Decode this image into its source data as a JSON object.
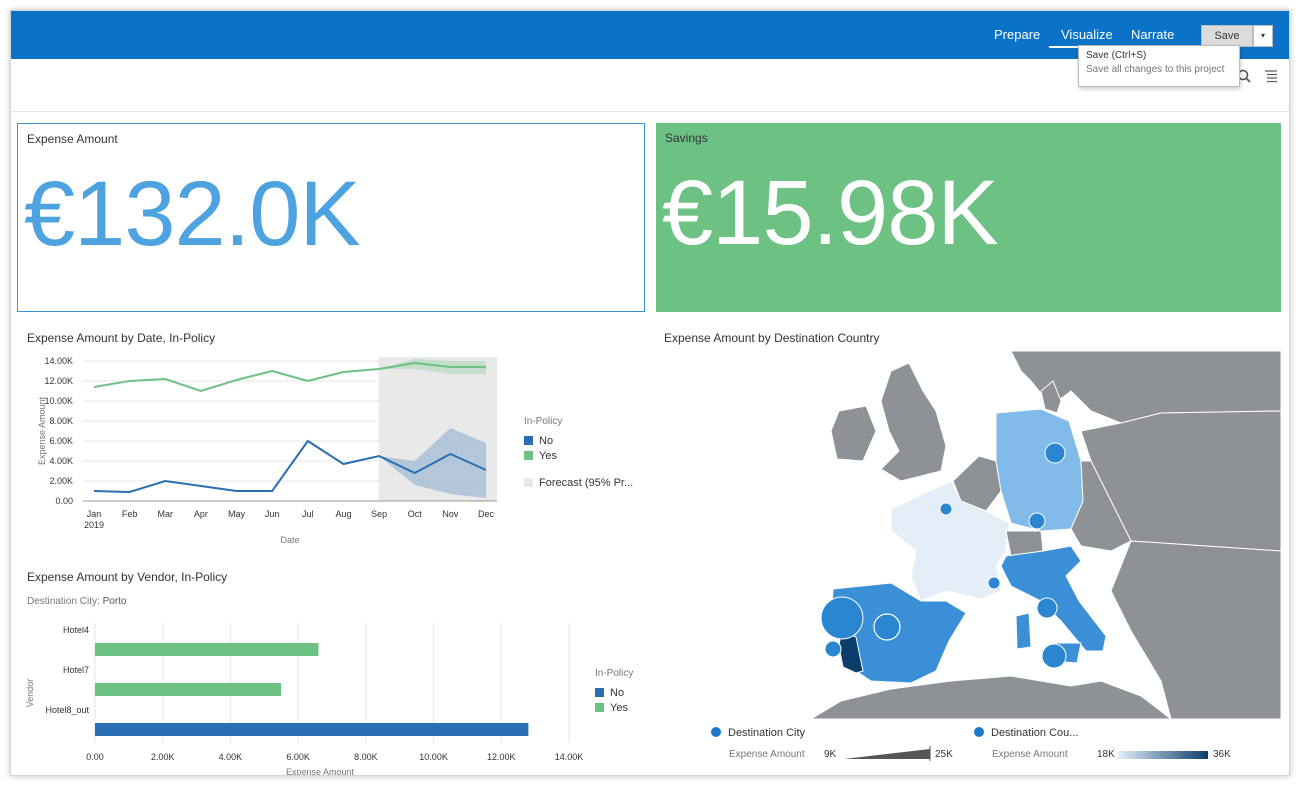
{
  "topbar": {
    "tabs": [
      "Prepare",
      "Visualize",
      "Narrate"
    ],
    "save_label": "Save",
    "dropdown_glyph": "▾"
  },
  "tooltip": {
    "line1": "Save (Ctrl+S)",
    "line2": "Save all changes to this project"
  },
  "icons": [
    "search-icon",
    "menu-icon"
  ],
  "kpis": {
    "expense": {
      "title": "Expense Amount",
      "value": "€132.0K"
    },
    "savings": {
      "title": "Savings",
      "value": "€15.98K"
    }
  },
  "colors": {
    "topbar": "#0a72c7",
    "kpi_blue": "#4da3e0",
    "kpi_green": "#6cc183",
    "series_no": "#2a6fb3",
    "series_yes": "#6cc183",
    "land": "#8e9196",
    "water": "#ffffff"
  },
  "line_chart": {
    "title": "Expense Amount by Date, In-Policy",
    "chart_data": {
      "type": "line",
      "x": [
        "Jan",
        "Feb",
        "Mar",
        "Apr",
        "May",
        "Jun",
        "Jul",
        "Aug",
        "Sep",
        "Oct",
        "Nov",
        "Dec"
      ],
      "x_sub_first": "2019",
      "xlabel": "Date",
      "ylabel": "Expense Amount",
      "ylim": [
        0,
        14000
      ],
      "yticks": [
        "0.00",
        "2.00K",
        "4.00K",
        "6.00K",
        "8.00K",
        "10.00K",
        "12.00K",
        "14.00K"
      ],
      "series": [
        {
          "name": "No",
          "values": [
            1000,
            900,
            2000,
            1500,
            1000,
            1000,
            6000,
            3700,
            4500,
            2800,
            4700,
            3100
          ],
          "forecast_band": [
            [
              4500,
              4500
            ],
            [
              1600,
              4000
            ],
            [
              700,
              7300
            ],
            [
              300,
              5800
            ]
          ]
        },
        {
          "name": "Yes",
          "values": [
            11400,
            12000,
            12200,
            11000,
            12100,
            13000,
            12000,
            12900,
            13200,
            13800,
            13400,
            13400
          ],
          "forecast_band": [
            [
              13200,
              13200
            ],
            [
              13200,
              14200
            ],
            [
              12700,
              14000
            ],
            [
              12700,
              14000
            ]
          ]
        }
      ],
      "forecast_start_index": 8,
      "legend": {
        "title": "In-Policy",
        "items": [
          "No",
          "Yes"
        ],
        "forecast_label": "Forecast (95% Pr..."
      },
      "legend_position": "right"
    }
  },
  "bar_chart": {
    "title": "Expense Amount by Vendor, In-Policy",
    "subtitle_label": "Destination City:",
    "subtitle_value": "Porto",
    "chart_data": {
      "type": "bar",
      "orientation": "horizontal",
      "categories": [
        "Hotel4",
        "Hotel7",
        "Hotel8_out"
      ],
      "series": [
        {
          "name": "Yes",
          "values": [
            6600,
            5500,
            null
          ]
        },
        {
          "name": "No",
          "values": [
            null,
            null,
            12800
          ]
        }
      ],
      "xlabel": "Expense Amount",
      "ylabel": "Vendor",
      "xlim": [
        0,
        14000
      ],
      "xticks": [
        "0.00",
        "2.00K",
        "4.00K",
        "6.00K",
        "8.00K",
        "10.00K",
        "12.00K",
        "14.00K"
      ],
      "legend": {
        "title": "In-Policy",
        "items": [
          "No",
          "Yes"
        ]
      },
      "legend_position": "right"
    }
  },
  "map": {
    "title": "Expense Amount by Destination Country",
    "legend": {
      "city_label": "Destination City",
      "city_measure": "Expense Amount",
      "city_min": "9K",
      "city_max": "25K",
      "country_label": "Destination Cou...",
      "country_measure": "Expense Amount",
      "country_min": "18K",
      "country_max": "36K"
    }
  }
}
